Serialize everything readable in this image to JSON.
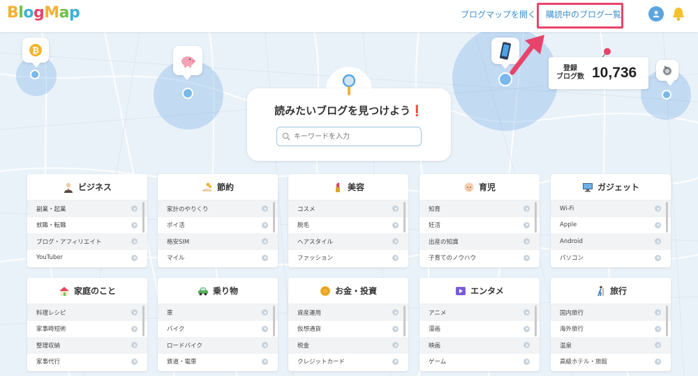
{
  "header": {
    "logo_text": "BlogMap",
    "nav_open_map": "ブログマップを開く",
    "nav_purchased": "購読中のブログ一覧"
  },
  "map": {
    "registered_label_line1": "登録",
    "registered_label_line2": "ブログ数",
    "registered_count": "10,736",
    "pins": [
      "bitcoin-icon",
      "piggy-bank-icon",
      "smartphone-icon",
      "robot-vacuum-icon"
    ]
  },
  "search": {
    "title": "読みたいブログを見つけよう",
    "exclamation": "❗",
    "placeholder": "キーワードを入力"
  },
  "categories": [
    {
      "title": "ビジネス",
      "icon": "businessman-icon",
      "items": [
        "副業・起業",
        "就職・転職",
        "ブログ・アフィリエイト",
        "YouTuber"
      ]
    },
    {
      "title": "節約",
      "icon": "coins-hand-icon",
      "items": [
        "家計のやりくり",
        "ポイ活",
        "格安SIM",
        "マイル"
      ]
    },
    {
      "title": "美容",
      "icon": "lipstick-icon",
      "items": [
        "コスメ",
        "脱毛",
        "ヘアスタイル",
        "ファッション"
      ]
    },
    {
      "title": "育児",
      "icon": "baby-icon",
      "items": [
        "知育",
        "妊活",
        "出産の知識",
        "子育てのノウハウ"
      ]
    },
    {
      "title": "ガジェット",
      "icon": "monitor-icon",
      "items": [
        "Wi-Fi",
        "Apple",
        "Android",
        "パソコン"
      ]
    },
    {
      "title": "家庭のこと",
      "icon": "house-icon",
      "items": [
        "料理レシピ",
        "家事時短術",
        "整理収納",
        "家事代行"
      ]
    },
    {
      "title": "乗り物",
      "icon": "car-icon",
      "items": [
        "車",
        "バイク",
        "ロードバイク",
        "鉄道・電車"
      ]
    },
    {
      "title": "お金・投資",
      "icon": "coin-icon",
      "items": [
        "資産運用",
        "仮想通貨",
        "税金",
        "クレジットカード"
      ]
    },
    {
      "title": "エンタメ",
      "icon": "play-icon",
      "items": [
        "アニメ",
        "漫画",
        "映画",
        "ゲーム"
      ]
    },
    {
      "title": "旅行",
      "icon": "hiker-icon",
      "items": [
        "国内旅行",
        "海外旅行",
        "温泉",
        "高級ホテル・旅館"
      ]
    }
  ],
  "colors": {
    "accent": "#3c8fcf",
    "highlight": "#e8436a",
    "map_circle": "#8fbde9"
  }
}
